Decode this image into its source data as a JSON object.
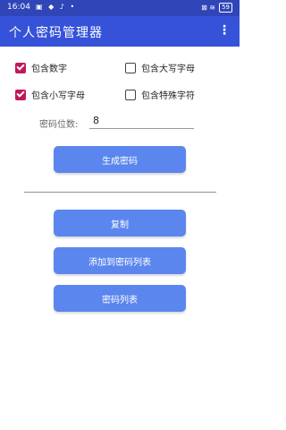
{
  "status_bar": {
    "time": "16:04",
    "left_icons": "▣ ◆ ♪ •",
    "right_icons": "⊠ ≋",
    "battery": "59"
  },
  "app_bar": {
    "title": "个人密码管理器",
    "menu_glyph": "⋮"
  },
  "options": [
    {
      "label": "包含数字",
      "checked": true
    },
    {
      "label": "包含大写字母",
      "checked": false
    },
    {
      "label": "包含小写字母",
      "checked": true
    },
    {
      "label": "包含特殊字符",
      "checked": false
    }
  ],
  "length": {
    "label": "密码位数:",
    "value": "8"
  },
  "buttons": {
    "generate": "生成密码",
    "copy": "复制",
    "add_to_list": "添加到密码列表",
    "password_list": "密码列表"
  },
  "colors": {
    "status_bar": "#2f45b8",
    "app_bar": "#3552d8",
    "button": "#5b86ee",
    "checkbox_checked": "#c2185b"
  }
}
